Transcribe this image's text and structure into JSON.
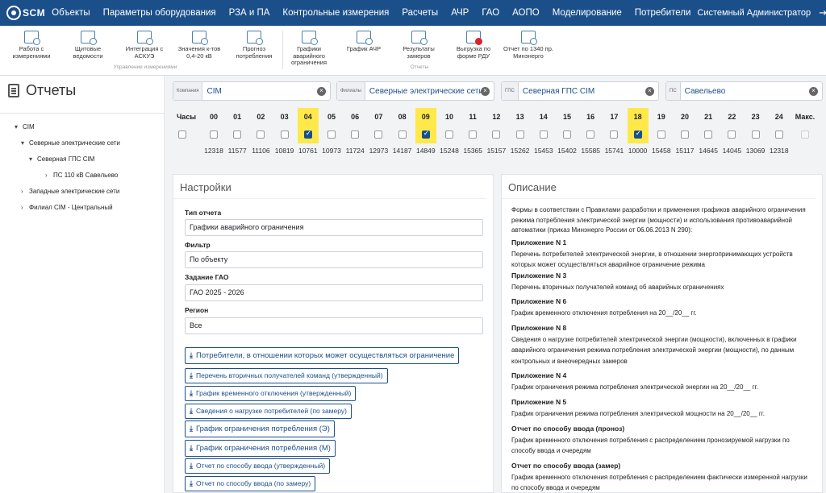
{
  "nav": {
    "logo_text": "SCM",
    "items": [
      "Объекты",
      "Параметры оборудования",
      "РЗА и ПА",
      "Контрольные измерения",
      "Расчеты",
      "АЧР",
      "ГАО",
      "АОПО",
      "Моделирование",
      "Потребители"
    ],
    "user": "Системный Администратор",
    "icons": [
      "logout-icon",
      "gear-icon",
      "help-icon"
    ]
  },
  "toolbar": {
    "buttons": [
      {
        "label": "Работа с измерениями",
        "icon": "measure-icon"
      },
      {
        "label": "Щитовые ведомости",
        "icon": "sheet-icon"
      },
      {
        "label": "Интеграция с АСКУЭ",
        "icon": "integration-icon"
      },
      {
        "label": "Значения к-тов 0,4-20 кВ",
        "icon": "coef-icon"
      },
      {
        "label": "Прогноз потребления",
        "icon": "forecast-icon"
      },
      {
        "label": "Графики аварийного ограничения",
        "icon": "schedule-icon"
      },
      {
        "label": "График АЧР",
        "icon": "achr-icon"
      },
      {
        "label": "Результаты замеров",
        "icon": "results-icon"
      },
      {
        "label": "Выгрузка по форме РДУ",
        "icon": "export-icon"
      },
      {
        "label": "Отчет по 1340 пр. Минэнерго",
        "icon": "report-icon"
      }
    ],
    "group1_label": "Управление измерениями",
    "group2_label": "Отчеты"
  },
  "sidebar": {
    "title": "Отчеты",
    "tree": [
      {
        "label": "CIM",
        "chev": "▾"
      },
      {
        "label": "Северные электрические сети",
        "chev": "▾"
      },
      {
        "label": "Северная ГПС CIM",
        "chev": "▾"
      },
      {
        "label": "ПС 110 кВ Савельево",
        "chev": "›"
      },
      {
        "label": "Западные электрические сети",
        "chev": "›"
      },
      {
        "label": "Филиал CIM - Центральный",
        "chev": "›"
      }
    ]
  },
  "filters": {
    "company": {
      "label": "Компания",
      "value": "CIM"
    },
    "branch": {
      "label": "Филиалы",
      "value": "Северные электрические сети"
    },
    "gps": {
      "label": "ГПС",
      "value": "Северная ГПС CIM"
    },
    "ps": {
      "label": "ПС",
      "value": "Савельево"
    }
  },
  "hours": {
    "header_label": "Часы",
    "max_label": "Макс.",
    "cols": [
      {
        "h": "00",
        "v": "12318",
        "sel": false
      },
      {
        "h": "01",
        "v": "11577",
        "sel": false
      },
      {
        "h": "02",
        "v": "11106",
        "sel": false
      },
      {
        "h": "03",
        "v": "10819",
        "sel": false
      },
      {
        "h": "04",
        "v": "10761",
        "sel": true
      },
      {
        "h": "05",
        "v": "10973",
        "sel": false
      },
      {
        "h": "06",
        "v": "11724",
        "sel": false
      },
      {
        "h": "07",
        "v": "12973",
        "sel": false
      },
      {
        "h": "08",
        "v": "14187",
        "sel": false
      },
      {
        "h": "09",
        "v": "14849",
        "sel": true
      },
      {
        "h": "10",
        "v": "15248",
        "sel": false
      },
      {
        "h": "11",
        "v": "15365",
        "sel": false
      },
      {
        "h": "12",
        "v": "15157",
        "sel": false
      },
      {
        "h": "13",
        "v": "15262",
        "sel": false
      },
      {
        "h": "14",
        "v": "15453",
        "sel": false
      },
      {
        "h": "15",
        "v": "15402",
        "sel": false
      },
      {
        "h": "16",
        "v": "15585",
        "sel": false
      },
      {
        "h": "17",
        "v": "15741",
        "sel": false
      },
      {
        "h": "18",
        "v": "10000",
        "sel": true
      },
      {
        "h": "19",
        "v": "15458",
        "sel": false
      },
      {
        "h": "20",
        "v": "15117",
        "sel": false
      },
      {
        "h": "21",
        "v": "14645",
        "sel": false
      },
      {
        "h": "22",
        "v": "14045",
        "sel": false
      },
      {
        "h": "23",
        "v": "13069",
        "sel": false
      },
      {
        "h": "24",
        "v": "12318",
        "sel": false
      }
    ]
  },
  "settings": {
    "title": "Настройки",
    "report_type_label": "Тип отчета",
    "report_type_value": "Графики аварийного ограничения",
    "filter_label": "Фильтр",
    "filter_value": "По объекту",
    "gao_label": "Задание ГАО",
    "gao_value": "ГАО 2025 - 2026",
    "region_label": "Регион",
    "region_value": "Все",
    "buttons": [
      "Потребители, в отношении которых может осуществляться ограничение",
      "Перечень вторичных получателей команд (утвержденный)",
      "График временного отключения (утвержденный)",
      "Сведения о нагрузке потребителей (по замеру)",
      "График ограничения потребления (Э)",
      "График ограничения потребления (М)",
      "Отчет по способу ввода (утвержденный)",
      "Отчет по способу ввода (по замеру)"
    ]
  },
  "description": {
    "title": "Описание",
    "intro": "Формы в соответствии с Правилами разработки и применения графиков аварийного ограничения режима потребления электрической энергии (мощности) и использования противоаварийной автоматики (приказ Минэнерго России от 06.06.2013 N 290):",
    "items": [
      {
        "head": "Приложение N 1",
        "text": "Перечень потребителей электрической энергии, в отношении энергопринимающих устройств которых может осуществляться аварийное ограничение режима"
      },
      {
        "head": "Приложение N 3",
        "text": "Перечень вторичных получателей команд об аварийных ограничениях"
      },
      {
        "head": "Приложение N 6",
        "text": "График временного отключения потребления на 20__/20__ гг."
      },
      {
        "head": "Приложение N 8",
        "text": "Сведения о нагрузке потребителей электрической энергии (мощности), включенных в графики аварийного ограничения режима потребления электрической энергии (мощности), по данным контрольных и внеочередных замеров"
      },
      {
        "head": "Приложение N 4",
        "text": "График ограничения режима потребления электрической энергии на 20__/20__ гг."
      },
      {
        "head": "Приложение N 5",
        "text": "График ограничения режима потребления электрической мощности на 20__/20__ гг."
      },
      {
        "head": "Отчет по способу ввода (проноз)",
        "text": "График временного отключения потребления с распределением пронозируемой нагрузки по способу ввода и очередям"
      },
      {
        "head": "Отчет по способу ввода (замер)",
        "text": "График временного отключения потребления с распределением фактически измеренной нагрузки по способу ввода и очередям"
      }
    ]
  }
}
